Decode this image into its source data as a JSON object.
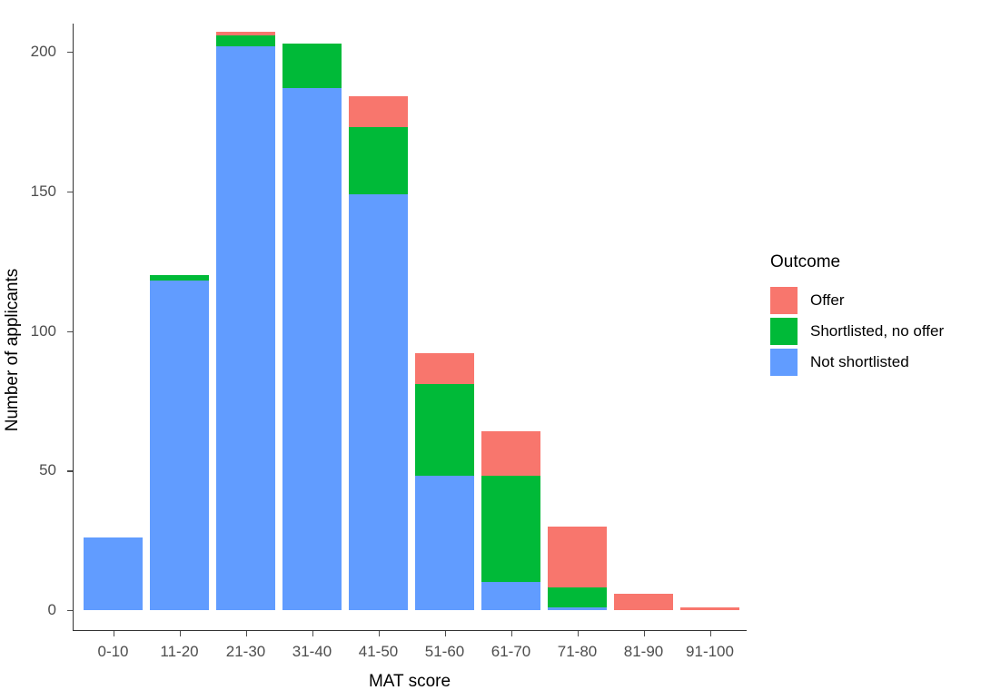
{
  "chart_data": {
    "type": "bar",
    "stacked": true,
    "title": "",
    "xlabel": "MAT score",
    "ylabel": "Number of applicants",
    "categories": [
      "0-10",
      "11-20",
      "21-30",
      "31-40",
      "41-50",
      "51-60",
      "61-70",
      "71-80",
      "81-90",
      "91-100"
    ],
    "series": [
      {
        "name": "Not shortlisted",
        "color": "#619CFF",
        "values": [
          26,
          118,
          202,
          187,
          149,
          48,
          10,
          1,
          0,
          0
        ]
      },
      {
        "name": "Shortlisted, no offer",
        "color": "#00BA38",
        "values": [
          0,
          2,
          4,
          16,
          24,
          33,
          38,
          7,
          0,
          0
        ]
      },
      {
        "name": "Offer",
        "color": "#F8766D",
        "values": [
          0,
          0,
          1,
          0,
          11,
          11,
          16,
          22,
          6,
          1
        ]
      }
    ],
    "stack_order_bottom_to_top": [
      "Not shortlisted",
      "Shortlisted, no offer",
      "Offer"
    ],
    "totals": [
      26,
      120,
      207,
      203,
      184,
      92,
      64,
      30,
      6,
      1
    ],
    "ylim": [
      0,
      215
    ],
    "yticks": [
      0,
      50,
      100,
      150,
      200
    ],
    "ytick_labels": [
      "0",
      "50",
      "100",
      "150",
      "200"
    ],
    "grid": false,
    "legend_position": "right",
    "legend": {
      "title": "Outcome",
      "entries": [
        {
          "label": "Offer",
          "color": "#F8766D"
        },
        {
          "label": "Shortlisted, no offer",
          "color": "#00BA38"
        },
        {
          "label": "Not shortlisted",
          "color": "#619CFF"
        }
      ]
    }
  }
}
